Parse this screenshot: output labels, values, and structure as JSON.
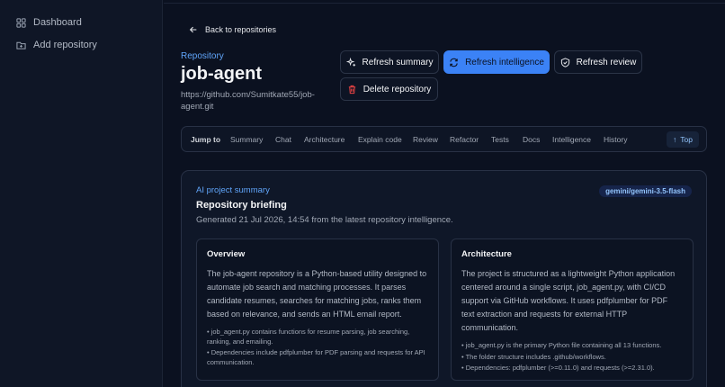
{
  "sidebar": {
    "items": [
      {
        "label": "Dashboard",
        "icon": "grid-icon"
      },
      {
        "label": "Add repository",
        "icon": "folder-plus-icon"
      }
    ]
  },
  "header": {
    "back_label": "Back to repositories",
    "eyebrow": "Repository",
    "title": "job-agent",
    "url": "https://github.com/Sumitkate55/job-agent.git"
  },
  "actions": {
    "refresh_summary": "Refresh summary",
    "refresh_intelligence": "Refresh intelligence",
    "refresh_review": "Refresh review",
    "delete_repository": "Delete repository"
  },
  "jump_nav": {
    "lead": "Jump to",
    "items": [
      "Summary",
      "Chat",
      "Architecture",
      "Explain code",
      "Review",
      "Refactor",
      "Tests",
      "Docs",
      "Intelligence",
      "History"
    ],
    "top_label": "Top"
  },
  "summary_card": {
    "eyebrow": "AI project summary",
    "title": "Repository briefing",
    "subtitle": "Generated 21 Jul 2026, 14:54 from the latest repository intelligence.",
    "model_badge": "gemini/gemini-3.5-flash",
    "overview": {
      "heading": "Overview",
      "text": "The job-agent repository is a Python-based utility designed to automate job search and matching processes. It parses candidate resumes, searches for matching jobs, ranks them based on relevance, and sends an HTML email report.",
      "bullets": [
        "• job_agent.py contains functions for resume parsing, job searching, ranking, and emailing.",
        "• Dependencies include pdfplumber for PDF parsing and requests for API communication."
      ]
    },
    "architecture": {
      "heading": "Architecture",
      "text": "The project is structured as a lightweight Python application centered around a single script, job_agent.py, with CI/CD support via GitHub workflows. It uses pdfplumber for PDF text extraction and requests for external HTTP communication.",
      "bullets": [
        "• job_agent.py is the primary Python file containing all 13 functions.",
        "• The folder structure includes .github/workflows.",
        "• Dependencies: pdfplumber (>=0.11.0) and requests (>=2.31.0)."
      ]
    }
  },
  "colors": {
    "background": "#0b1120",
    "accent": "#3b82f6",
    "accent_text": "#60a5fa",
    "danger": "#ef4444"
  }
}
